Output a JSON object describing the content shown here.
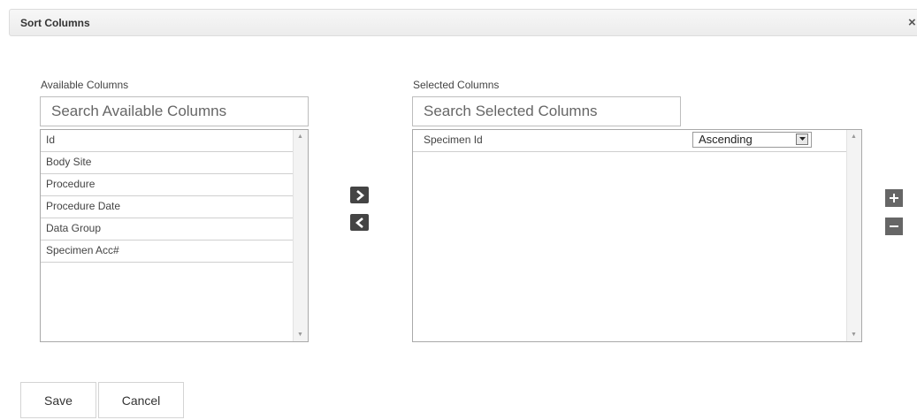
{
  "dialog": {
    "title": "Sort Columns",
    "close_icon": "×"
  },
  "available": {
    "label": "Available Columns",
    "search_placeholder": "Search Available Columns",
    "items": [
      "Id",
      "Body Site",
      "Procedure",
      "Procedure Date",
      "Data Group",
      "Specimen Acc#"
    ]
  },
  "selected": {
    "label": "Selected Columns",
    "search_placeholder": "Search Selected Columns",
    "items": [
      {
        "name": "Specimen Id",
        "order": "Ascending"
      }
    ]
  },
  "icons": {
    "move_right": "chevron-right-icon",
    "move_left": "chevron-left-icon",
    "add": "plus-icon",
    "remove": "minus-icon"
  },
  "footer": {
    "save_label": "Save",
    "cancel_label": "Cancel"
  }
}
